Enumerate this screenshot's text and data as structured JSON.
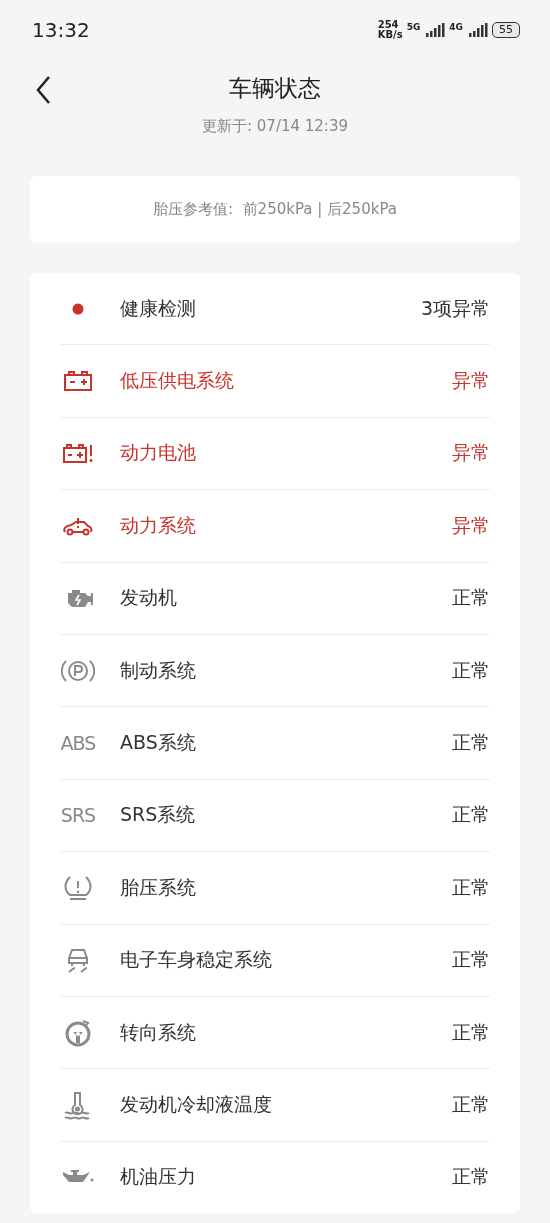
{
  "status_bar": {
    "time": "13:32",
    "speed_value": "254",
    "speed_unit": "KB/s",
    "network_1": "5G",
    "network_2": "4G",
    "battery": "55"
  },
  "header": {
    "title": "车辆状态",
    "updated": "更新于: 07/14 12:39"
  },
  "tire_reference": {
    "text": "胎压参考值:  前250kPa | 后250kPa"
  },
  "items": [
    {
      "kind": "dot",
      "label": "健康检测",
      "status": "3项异常",
      "abnormal": false
    },
    {
      "kind": "battery",
      "label": "低压供电系统",
      "status": "异常",
      "abnormal": true
    },
    {
      "kind": "battery-alert",
      "label": "动力电池",
      "status": "异常",
      "abnormal": true
    },
    {
      "kind": "car-alert",
      "label": "动力系统",
      "status": "异常",
      "abnormal": true
    },
    {
      "kind": "engine",
      "label": "发动机",
      "status": "正常",
      "abnormal": false
    },
    {
      "kind": "brake",
      "label": "制动系统",
      "status": "正常",
      "abnormal": false
    },
    {
      "kind": "text",
      "icon_text": "ABS",
      "label": "ABS系统",
      "status": "正常",
      "abnormal": false
    },
    {
      "kind": "text",
      "icon_text": "SRS",
      "label": "SRS系统",
      "status": "正常",
      "abnormal": false
    },
    {
      "kind": "tire",
      "label": "胎压系统",
      "status": "正常",
      "abnormal": false
    },
    {
      "kind": "stability",
      "label": "电子车身稳定系统",
      "status": "正常",
      "abnormal": false
    },
    {
      "kind": "steering",
      "label": "转向系统",
      "status": "正常",
      "abnormal": false
    },
    {
      "kind": "coolant",
      "label": "发动机冷却液温度",
      "status": "正常",
      "abnormal": false
    },
    {
      "kind": "oil",
      "label": "机油压力",
      "status": "正常",
      "abnormal": false
    }
  ]
}
